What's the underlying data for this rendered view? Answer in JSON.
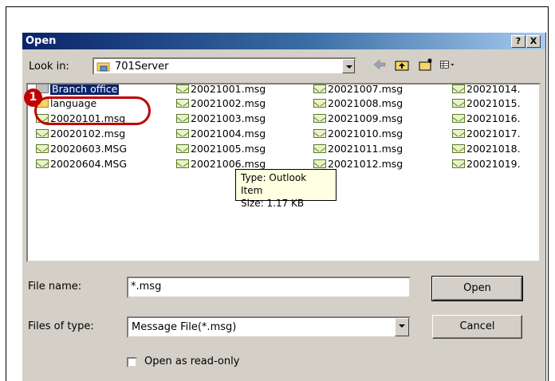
{
  "dialog": {
    "title": "Open",
    "title_buttons": {
      "help": "?",
      "close": "X"
    }
  },
  "look_in": {
    "label": "Look in:",
    "value": "701Server",
    "icon": "folder-network-icon"
  },
  "toolbar": {
    "icons": [
      "back-icon",
      "up-folder-icon",
      "new-folder-icon",
      "view-menu-icon"
    ]
  },
  "files": {
    "columns": [
      [
        {
          "name": "Branch office",
          "type": "folder-special",
          "selected": true
        },
        {
          "name": "language",
          "type": "folder"
        },
        {
          "name": "20020101.msg",
          "type": "msg"
        },
        {
          "name": "20020102.msg",
          "type": "msg"
        },
        {
          "name": "20020603.MSG",
          "type": "msg"
        },
        {
          "name": "20020604.MSG",
          "type": "msg"
        }
      ],
      [
        {
          "name": "20021001.msg",
          "type": "msg"
        },
        {
          "name": "20021002.msg",
          "type": "msg"
        },
        {
          "name": "20021003.msg",
          "type": "msg"
        },
        {
          "name": "20021004.msg",
          "type": "msg"
        },
        {
          "name": "20021005.msg",
          "type": "msg"
        },
        {
          "name": "20021006.msg",
          "type": "msg"
        }
      ],
      [
        {
          "name": "20021007.msg",
          "type": "msg"
        },
        {
          "name": "20021008.msg",
          "type": "msg"
        },
        {
          "name": "20021009.msg",
          "type": "msg"
        },
        {
          "name": "20021010.msg",
          "type": "msg"
        },
        {
          "name": "20021011.msg",
          "type": "msg"
        },
        {
          "name": "20021012.msg",
          "type": "msg"
        }
      ],
      [
        {
          "name": "20021014.",
          "type": "msg"
        },
        {
          "name": "20021015.",
          "type": "msg"
        },
        {
          "name": "20021016.",
          "type": "msg"
        },
        {
          "name": "20021017.",
          "type": "msg"
        },
        {
          "name": "20021018.",
          "type": "msg"
        },
        {
          "name": "20021019.",
          "type": "msg"
        }
      ]
    ]
  },
  "tooltip": {
    "type_line": "Type: Outlook Item",
    "size_line": "Size: 1.17 KB"
  },
  "form": {
    "filename_label": "File name:",
    "filename_value": "*.msg",
    "filetype_label": "Files of type:",
    "filetype_value": "Message File(*.msg)",
    "open_button": "Open",
    "cancel_button": "Cancel",
    "readonly_label": "Open as read-only"
  },
  "annotation": {
    "marker": "1"
  },
  "colors": {
    "titlebar_start": "#0a246a",
    "selection": "#0a246a",
    "annotation": "#c00000",
    "dialog_face": "#d4d0c8"
  }
}
